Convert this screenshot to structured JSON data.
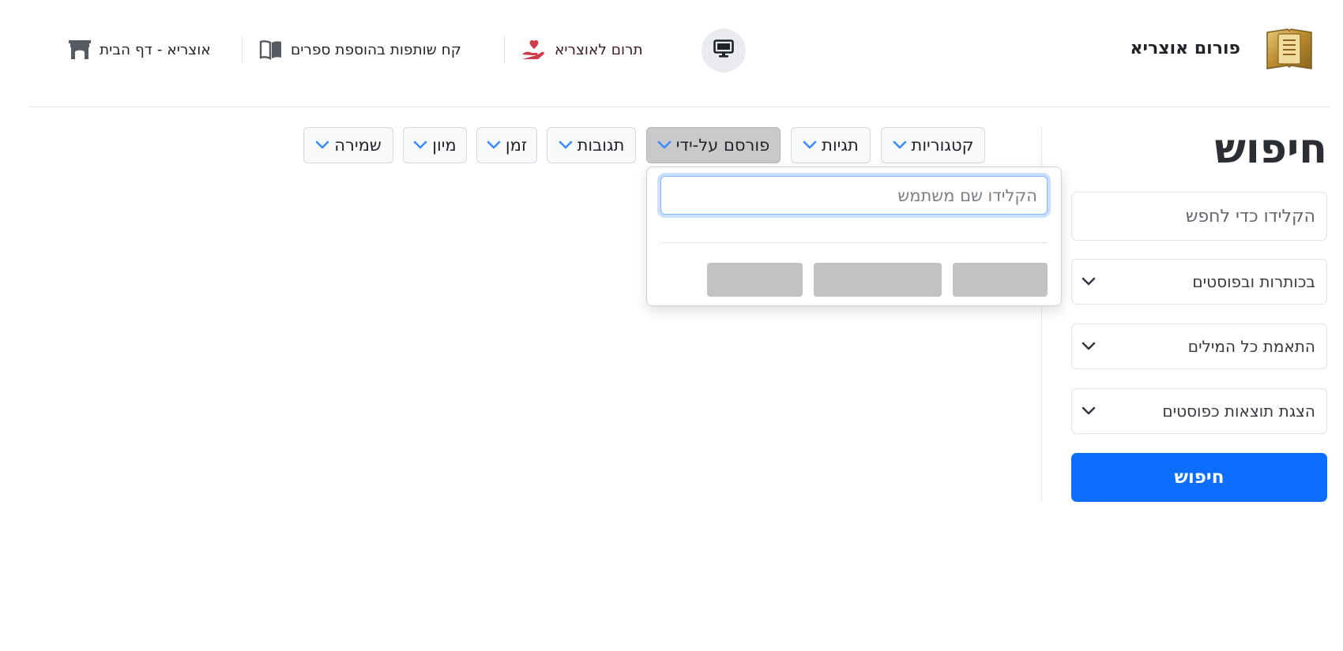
{
  "header": {
    "brand": "פורום אוצריא",
    "links": {
      "donate": "תרום לאוצריא",
      "books": "קח שותפות בהוספת ספרים",
      "home": "אוצריא - דף הבית"
    },
    "icons": {
      "logo": "book-logo-icon",
      "monitor": "monitor-icon",
      "donate": "hand-heart-icon",
      "books": "open-book-icon",
      "home": "archway-icon"
    },
    "colors": {
      "donate_icon": "#d03a4a",
      "donate_text": "#3c1a1e",
      "logo_gold": "#c49a3d"
    }
  },
  "sidebar": {
    "title": "חיפוש",
    "keyword_placeholder": "הקלידו כדי לחפש",
    "selects": [
      {
        "value": "בכותרות ובפוסטים"
      },
      {
        "value": "התאמת כל המילים"
      },
      {
        "value": "הצגת תוצאות כפוסטים"
      }
    ],
    "submit_label": "חיפוש",
    "colors": {
      "primary": "#0d6efd"
    }
  },
  "filters": {
    "items": [
      {
        "label": "קטגוריות"
      },
      {
        "label": "תגיות"
      },
      {
        "label": "פורסם על-ידי",
        "active": true
      },
      {
        "label": "תגובות"
      },
      {
        "label": "זמן"
      },
      {
        "label": "מיון"
      },
      {
        "label": "שמירה"
      }
    ],
    "chevron_icon": "chevron-down-icon",
    "chevron_color": "#3d8bfd"
  },
  "dropdown": {
    "user_placeholder": "הקלידו שם משתמש"
  }
}
